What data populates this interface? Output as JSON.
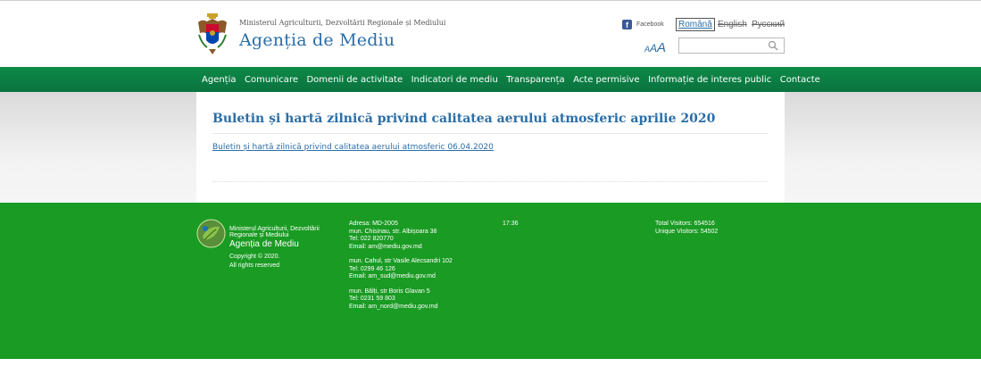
{
  "header": {
    "ministry_name": "Ministerul Agriculturii, Dezvoltării Regionale și Mediului",
    "agency_name": "Agenția de Mediu",
    "facebook_label": "Facebook",
    "languages": [
      "Română",
      "English",
      "Русский"
    ],
    "font_sizes": [
      "A",
      "A",
      "A"
    ],
    "search_placeholder": ""
  },
  "nav": {
    "items": [
      "Agenția",
      "Comunicare",
      "Domenii de activitate",
      "Indicatori de mediu",
      "Transparența",
      "Acte permisive",
      "Informație de interes public",
      "Contacte"
    ]
  },
  "main": {
    "title": "Buletin și hartă zilnică privind calitatea aerului atmosferic aprilie 2020",
    "link": "Buletin și hartă zilnică privind calitatea aerului atmosferic 06.04.2020"
  },
  "footer": {
    "ministry_name": "Ministerul Agriculturii, Dezvoltării Regionale și Mediului",
    "agency_name": "Agenția de Mediu",
    "copyright": "Copyright © 2020.",
    "rights": "All rights reserved",
    "address_blocks": [
      [
        "Adresa: MD-2005",
        "mun. Chisinau, str. Albișoara 38",
        "Tel: 022 820770",
        "Email: am@mediu.gov.md"
      ],
      [
        "mun. Cahul, str Vasile Alecsandri 102",
        "Tel: 0299 46 126",
        "Email: am_sud@mediu.gov.md"
      ],
      [
        "mun. Bălți, str Boris Glavan 5",
        "Tel: 0231 59 803",
        "Email: am_nord@mediu.gov.md"
      ]
    ],
    "time": "17:36",
    "total_visitors": "Total Visitors: 654516",
    "unique_visitors": "Unique Visitors: 54502"
  },
  "colors": {
    "nav_green": "#0b7d43",
    "footer_green": "#1a9b23",
    "link_blue": "#2a6ea8"
  },
  "icons": {
    "emblem": "moldova-coat-of-arms-icon",
    "facebook": "facebook-icon",
    "search": "search-icon",
    "footer_logo": "leaf-logo-icon"
  }
}
